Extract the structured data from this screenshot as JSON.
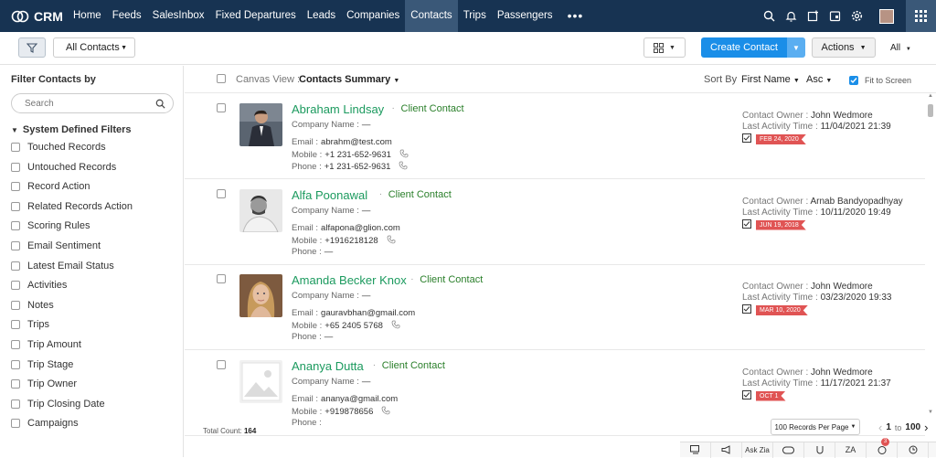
{
  "app": {
    "name": "CRM"
  },
  "nav": {
    "tabs": [
      {
        "label": "Home",
        "active": false
      },
      {
        "label": "Feeds",
        "active": false
      },
      {
        "label": "SalesInbox",
        "active": false
      },
      {
        "label": "Fixed Departures",
        "active": false
      },
      {
        "label": "Leads",
        "active": false
      },
      {
        "label": "Companies",
        "active": false
      },
      {
        "label": "Contacts",
        "active": true
      },
      {
        "label": "Trips",
        "active": false
      },
      {
        "label": "Passengers",
        "active": false
      }
    ],
    "more": "•••",
    "icons": [
      "search-icon",
      "notification-bell-icon",
      "compose-icon",
      "calendar-icon",
      "settings-gear-icon"
    ],
    "colors": {
      "navbar": "#173352",
      "active_tab": "#3a5878"
    }
  },
  "toolbar": {
    "view_select": "All Contacts",
    "create_button": "Create Contact",
    "actions_button": "Actions",
    "all_dropdown": "All",
    "colors": {
      "primary": "#1a8ee8"
    }
  },
  "sidebar": {
    "title": "Filter Contacts by",
    "search_placeholder": "Search",
    "group_label": "System Defined Filters",
    "filters": [
      "Touched Records",
      "Untouched Records",
      "Record Action",
      "Related Records Action",
      "Scoring Rules",
      "Email Sentiment",
      "Latest Email Status",
      "Activities",
      "Notes",
      "Trips",
      "Trip Amount",
      "Trip Stage",
      "Trip Owner",
      "Trip Closing Date",
      "Campaigns"
    ]
  },
  "list_header": {
    "canvas_label": "Canvas View :",
    "canvas_value": "Contacts Summary",
    "sort_label": "Sort By",
    "sort_field": "First Name",
    "sort_dir": "Asc",
    "fit_label": "Fit to Screen",
    "fit_checked": true
  },
  "labels": {
    "company_name": "Company Name :",
    "email": "Email :",
    "mobile": "Mobile :",
    "phone": "Phone :",
    "owner": "Contact Owner :",
    "last_activity": "Last Activity Time :",
    "dash": "—"
  },
  "contacts": [
    {
      "name": "Abraham Lindsay",
      "type": "Client Contact",
      "company": "—",
      "email": "abrahm@test.com",
      "mobile": "+1 231-652-9631",
      "phone": "+1 231-652-9631",
      "owner": "John Wedmore",
      "last_activity": "11/04/2021 21:39",
      "flag": "FEB 24, 2020",
      "photo": "man-in-suit"
    },
    {
      "name": "Alfa Poonawal",
      "type": "Client Contact",
      "company": "—",
      "email": "alfapona@glion.com",
      "mobile": "+1916218128",
      "phone": "—",
      "owner": "Arnab Bandyopadhyay",
      "last_activity": "10/11/2020 19:49",
      "flag": "JUN 19, 2018",
      "photo": "man-bw"
    },
    {
      "name": "Amanda Becker Knox",
      "type": "Client Contact",
      "company": "—",
      "email": "gauravbhan@gmail.com",
      "mobile": "+65 2405 5768",
      "phone": "—",
      "owner": "John Wedmore",
      "last_activity": "03/23/2020 19:33",
      "flag": "MAR 10, 2020",
      "photo": "woman-blonde"
    },
    {
      "name": "Ananya Dutta",
      "type": "Client Contact",
      "company": "—",
      "email": "ananya@gmail.com",
      "mobile": "+919878656",
      "phone": "",
      "owner": "John Wedmore",
      "last_activity": "11/17/2021 21:37",
      "flag": "OCT 1",
      "photo": "placeholder"
    }
  ],
  "footer": {
    "total_label": "Total Count:",
    "total_value": "164",
    "records_per_page": "100 Records Per Page",
    "page_from": "1",
    "page_to_label": "to",
    "page_to": "100"
  },
  "bottom_bar": {
    "ask_zia": "Ask Zia",
    "badge_count": "3"
  }
}
